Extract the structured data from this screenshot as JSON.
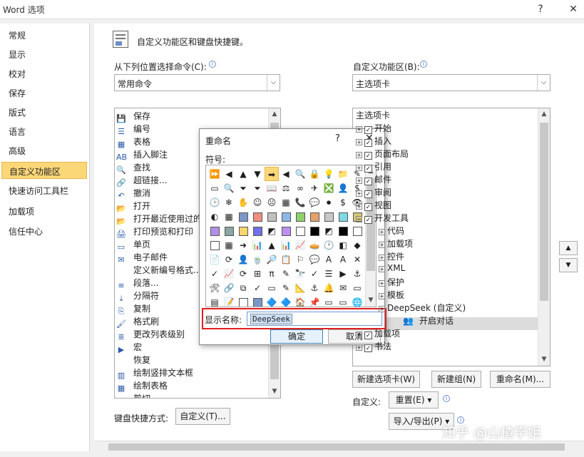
{
  "window": {
    "title": "Word 选项",
    "help_glyph": "?",
    "close_glyph": "✕"
  },
  "sidebar": {
    "items": [
      {
        "label": "常规"
      },
      {
        "label": "显示"
      },
      {
        "label": "校对"
      },
      {
        "label": "保存"
      },
      {
        "label": "版式"
      },
      {
        "label": "语言"
      },
      {
        "label": "高级"
      },
      {
        "label": "自定义功能区"
      },
      {
        "label": "快速访问工具栏"
      },
      {
        "label": "加载项"
      },
      {
        "label": "信任中心"
      }
    ],
    "active_index": 7
  },
  "main": {
    "header": "自定义功能区和键盘快捷键。",
    "left": {
      "label": "从下列位置选择命令(C):",
      "selected": "常用命令",
      "commands": [
        "保存",
        "编号",
        "表格",
        "插入脚注",
        "查找",
        "超链接...",
        "撤消",
        "打开",
        "打开最近使用过的",
        "打印预览和打印",
        "单页",
        "电子邮件",
        "定义新编号格式...",
        "段落...",
        "分隔符",
        "复制",
        "格式刷",
        "更改列表级别",
        "宏",
        "恢复",
        "绘制竖排文本框",
        "绘制表格",
        "剪切"
      ],
      "command_icons": [
        "💾",
        "☰",
        "▦",
        "AB",
        "🔍",
        "🔗",
        "↶",
        "📂",
        "📂",
        "🖨",
        "▭",
        "✉",
        "",
        "≡",
        "⤓",
        "⎘",
        "🖌",
        "≣",
        "▶",
        "",
        "▥",
        "▦",
        "✂"
      ]
    },
    "right": {
      "label": "自定义功能区(B):",
      "selected": "主选项卡",
      "tree": [
        {
          "text": "主选项卡",
          "level": 0
        },
        {
          "text": "开始",
          "level": 1
        },
        {
          "text": "插入",
          "level": 1
        },
        {
          "text": "页面布局",
          "level": 1
        },
        {
          "text": "引用",
          "level": 1
        },
        {
          "text": "邮件",
          "level": 1
        },
        {
          "text": "审阅",
          "level": 1
        },
        {
          "text": "视图",
          "level": 1
        },
        {
          "text": "开发工具",
          "level": 1
        },
        {
          "text": "代码",
          "level": 2
        },
        {
          "text": "加载项",
          "level": 2
        },
        {
          "text": "控件",
          "level": 2
        },
        {
          "text": "XML",
          "level": 2
        },
        {
          "text": "保护",
          "level": 2
        },
        {
          "text": "模板",
          "level": 2
        },
        {
          "text": "DeepSeek (自定义)",
          "level": 2
        },
        {
          "text": "开启对话",
          "level": 3
        },
        {
          "text": "加载项",
          "level": 1
        },
        {
          "text": "书法",
          "level": 1
        }
      ],
      "buttons": {
        "new_tab": "新建选项卡(W)",
        "new_group": "新建组(N)",
        "rename": "重命名(M)..."
      },
      "custom_label": "自定义:",
      "reset": "重置(E) ▾",
      "import_export": "导入/导出(P) ▾",
      "up_glyph": "▲",
      "down_glyph": "▼"
    },
    "keyboard": {
      "label": "键盘快捷方式:",
      "button": "自定义(T)..."
    }
  },
  "dialog": {
    "title": "重命名",
    "help_glyph": "?",
    "close_glyph": "✕",
    "symbol_label": "符号:",
    "display_label": "显示名称:",
    "display_value": "DeepSeek",
    "ok": "确定",
    "cancel": "取消",
    "symbols": [
      "⏩",
      "◀",
      "▲",
      "▼",
      "➡",
      "◀",
      "🔍",
      "🔒",
      "💡",
      "📁",
      "✎",
      "▭",
      "🔍",
      "⏷",
      "⏷",
      "📖",
      "⚖",
      "∞",
      "✈",
      "❎",
      "👤",
      "$",
      "🕒",
      "❄",
      "✋",
      "☺",
      "☹",
      "▦",
      "📞",
      "💬",
      "⏺",
      "$",
      "👁",
      "◐",
      "▦",
      "▢",
      "■",
      "■",
      "■",
      "■",
      "■",
      "■",
      "■",
      "■",
      "■",
      "■",
      "■",
      "■",
      "◩",
      "■",
      "▢",
      "▢",
      "◩",
      "▢",
      "▢",
      "■",
      "▦",
      "➜",
      "📊",
      "▲",
      "📊",
      "📈",
      "🥧",
      "🕐",
      "◧",
      "◆",
      "📄",
      "⟳",
      "👤",
      "🍵",
      "🔎",
      "📋",
      "⚐",
      "💬",
      "A",
      "A",
      "✕",
      "✓",
      "📈",
      "⟳",
      "⊞",
      "π",
      "✎",
      "🔭",
      "✓",
      "☰",
      "▶",
      "⚓",
      "🛠",
      "🔗",
      "⧉",
      "✓",
      "▭",
      "✎",
      "📐",
      "⚓",
      "🔔",
      "✉",
      "▭",
      "▤",
      "📝",
      "■",
      "■",
      "🔷",
      "🔷",
      "🏠",
      "📌",
      "▭",
      "▭",
      "🌐"
    ],
    "swatch_colors": [
      "#7a97c8",
      "#ee8f80",
      "#c0c0c0",
      "#8db8e8",
      "#8fd06a",
      "#e4a26b",
      "#c8c8c8",
      "#7fd8e6",
      "#d4c774",
      "#b290e8",
      "#8aa7a0",
      "#f5d56e",
      "#7070e8",
      "#c090f0",
      "#ffffff",
      "#000000",
      "#000000",
      "#ffffff",
      "#ffffff",
      "#ffffff"
    ]
  },
  "watermark": "知乎 @山楂学姐"
}
